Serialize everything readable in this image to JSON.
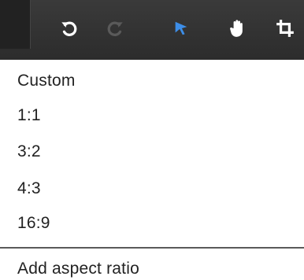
{
  "toolbar": {
    "tools": [
      {
        "icon": "undo-icon",
        "color": "#ffffff"
      },
      {
        "icon": "redo-icon",
        "color": "#5a5a5a"
      },
      {
        "icon": "pointer-arrow-icon",
        "color": "#3d8ee8"
      },
      {
        "icon": "hand-pan-icon",
        "color": "#ffffff"
      },
      {
        "icon": "crop-icon",
        "color": "#ffffff"
      }
    ]
  },
  "aspect_menu": {
    "items": [
      {
        "label": "Custom"
      },
      {
        "label": "1:1"
      },
      {
        "label": "3:2"
      },
      {
        "label": "4:3"
      },
      {
        "label": "16:9"
      }
    ],
    "add_label": "Add aspect ratio"
  }
}
